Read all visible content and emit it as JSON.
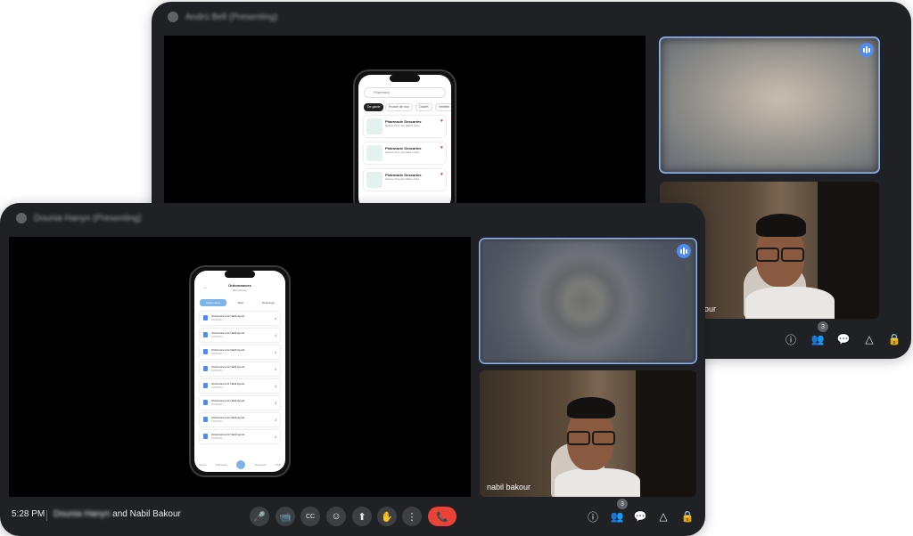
{
  "back_window": {
    "title": "Andrú Bell (Presenting)",
    "participant_count": "3",
    "phone_app": {
      "search_placeholder": "Pharmacy",
      "chips": [
        "De garde",
        "Proche de moi",
        "Ouvert",
        "Vérifiée"
      ],
      "cards": [
        {
          "name": "Pharmacie Descartes",
          "address": "Adresse: 60 av. des Nations Unies"
        },
        {
          "name": "Pharmacie Descartes",
          "address": "Adresse: 60 av. des Nations Unies"
        },
        {
          "name": "Pharmacie Descartes",
          "address": "Adresse: 60 av. des Nations Unies"
        }
      ]
    },
    "tiles": [
      {
        "name": "",
        "speaking": true
      },
      {
        "name": "our",
        "speaking": false
      }
    ]
  },
  "front_window": {
    "title": "Dounia Hanyn (Presenting)",
    "time": "5:28 PM",
    "participants_blurred": "Dounia Hanyn",
    "participants_text": "and Nabil Bakour",
    "participant_count": "3",
    "phone_app": {
      "title": "Ordonnances",
      "subtitle": "Mes fichiers",
      "tabs": [
        "Ordonnance",
        "Bilan",
        "Radiologie"
      ],
      "rows": [
        {
          "name": "Ordonnance Dr Nabil Ayoub",
          "date": "10/06/2024"
        },
        {
          "name": "Ordonnance Dr Nabil Ayoub",
          "date": "10/06/2024"
        },
        {
          "name": "Ordonnance Dr Nabil Ayoub",
          "date": "10/06/2024"
        },
        {
          "name": "Ordonnance Dr Nabil Ayoub",
          "date": "10/06/2024"
        },
        {
          "name": "Ordonnance Dr Nabil Ayoub",
          "date": "10/06/2024"
        },
        {
          "name": "Ordonnance Dr Nabil Ayoub",
          "date": "10/06/2024"
        },
        {
          "name": "Ordonnance Dr Nabil Ayoub",
          "date": "10/06/2024"
        },
        {
          "name": "Ordonnance Dr Nabil Ayoub",
          "date": "10/06/2024"
        }
      ],
      "nav": [
        "Accueil",
        "Pharmacies",
        "",
        "Documents",
        "Profil"
      ]
    },
    "tiles": [
      {
        "name": "",
        "speaking": true
      },
      {
        "name": "nabil bakour",
        "speaking": false
      }
    ],
    "controls": {
      "mic": "🎤",
      "camera": "📹",
      "captions": "CC",
      "emoji": "☺",
      "present": "⬆",
      "hand": "✋",
      "more": "⋮",
      "end": "📞"
    },
    "tray_icons": {
      "info": "ⓘ",
      "people": "👥",
      "chat": "💬",
      "activities": "△",
      "host": "🔒"
    }
  },
  "colors": {
    "window_bg": "#202124",
    "speaking_outline": "#8ab4f8",
    "end_call": "#ea4335"
  }
}
